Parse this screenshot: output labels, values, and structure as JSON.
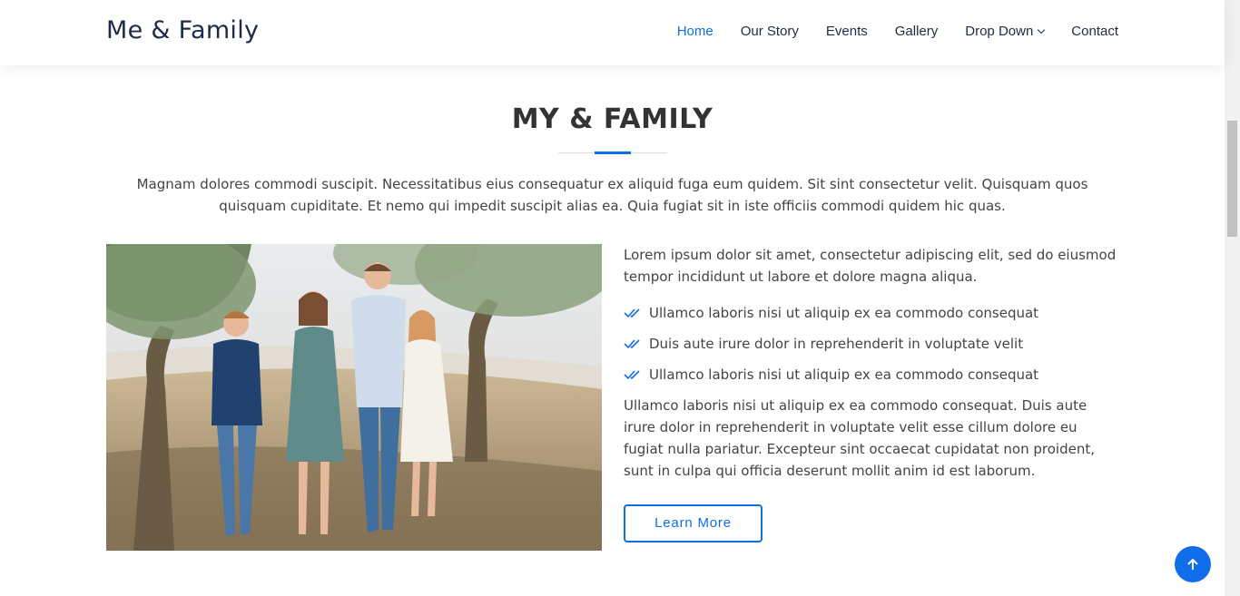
{
  "header": {
    "logo": "Me & Family",
    "nav": [
      {
        "label": "Home",
        "active": true
      },
      {
        "label": "Our Story"
      },
      {
        "label": "Events"
      },
      {
        "label": "Gallery"
      },
      {
        "label": "Drop Down",
        "dropdown": true
      },
      {
        "label": "Contact"
      }
    ]
  },
  "about": {
    "title": "MY & FAMILY",
    "intro": "Magnam dolores commodi suscipit. Necessitatibus eius consequatur ex aliquid fuga eum quidem. Sit sint consectetur velit. Quisquam quos quisquam cupiditate. Et nemo qui impedit suscipit alias ea. Quia fugiat sit in iste officiis commodi quidem hic quas.",
    "lead": "Lorem ipsum dolor sit amet, consectetur adipiscing elit, sed do eiusmod tempor incididunt ut labore et dolore magna aliqua.",
    "list": [
      "Ullamco laboris nisi ut aliquip ex ea commodo consequat",
      "Duis aute irure dolor in reprehenderit in voluptate velit",
      "Ullamco laboris nisi ut aliquip ex ea commodo consequat"
    ],
    "paragraph": "Ullamco laboris nisi ut aliquip ex ea commodo consequat. Duis aute irure dolor in reprehenderit in voluptate velit esse cillum dolore eu fugiat nulla pariatur. Excepteur sint occaecat cupidatat non proident, sunt in culpa qui officia deserunt mollit anim id est laborum.",
    "button": "Learn More"
  },
  "icons": {
    "list_check": "double-check-icon",
    "back_to_top": "arrow-up-icon",
    "dropdown": "chevron-down-icon"
  },
  "colors": {
    "accent": "#106eea",
    "heading": "#1e2a4a",
    "text": "#444444"
  }
}
